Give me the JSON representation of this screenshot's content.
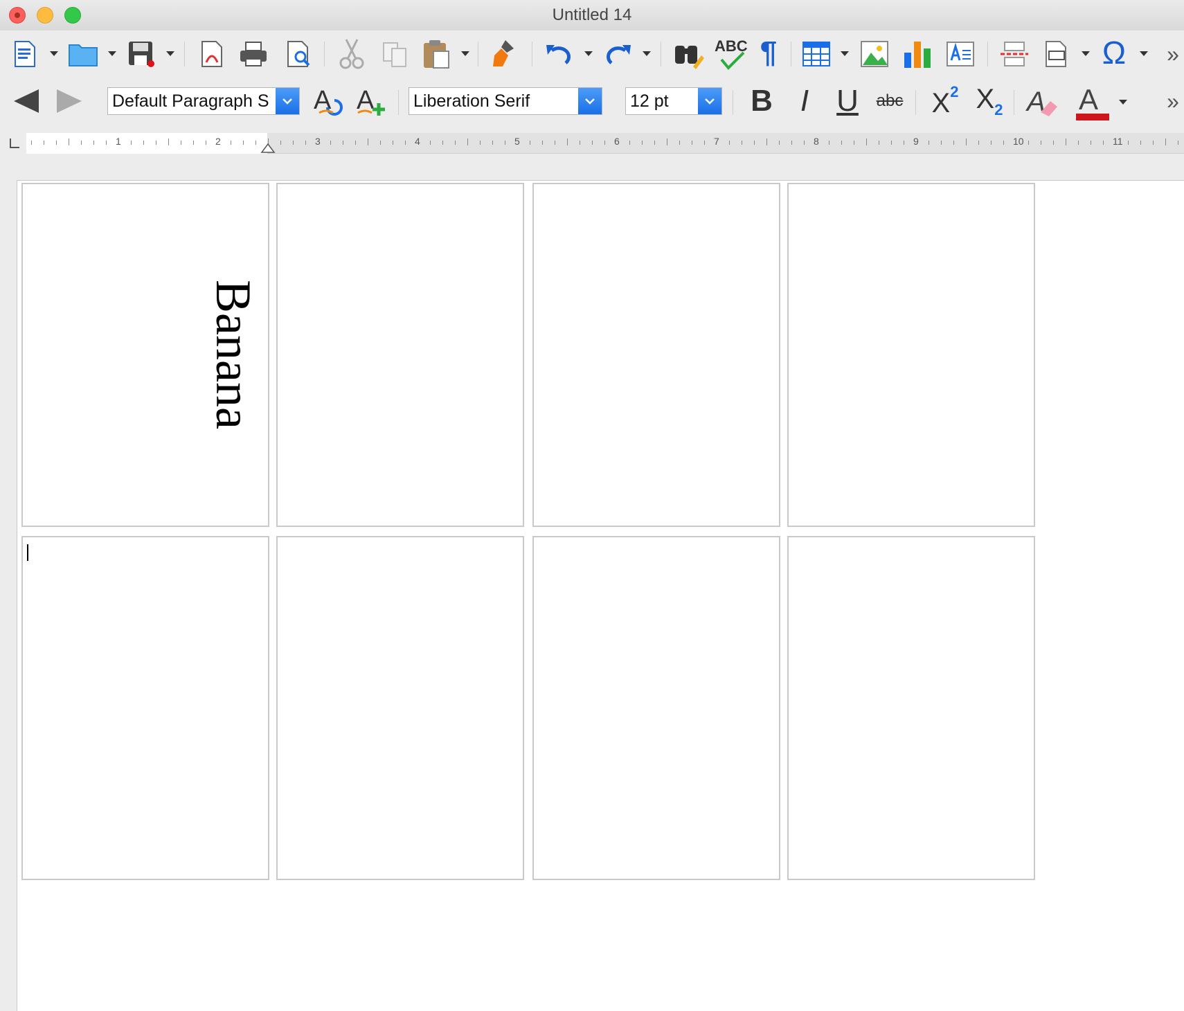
{
  "window": {
    "title": "Untitled 14"
  },
  "toolbar_standard": {
    "items": [
      {
        "name": "new-document",
        "icon": "document-icon"
      },
      {
        "name": "open",
        "icon": "folder-icon"
      },
      {
        "name": "save",
        "icon": "save-icon"
      },
      {
        "name": "export-pdf",
        "icon": "pdf-icon"
      },
      {
        "name": "print",
        "icon": "printer-icon"
      },
      {
        "name": "print-preview",
        "icon": "preview-icon"
      },
      {
        "name": "cut",
        "icon": "scissors-icon"
      },
      {
        "name": "copy",
        "icon": "copy-icon"
      },
      {
        "name": "paste",
        "icon": "clipboard-icon"
      },
      {
        "name": "clone-formatting",
        "icon": "paintbrush-icon"
      },
      {
        "name": "undo",
        "icon": "undo-icon"
      },
      {
        "name": "redo",
        "icon": "redo-icon"
      },
      {
        "name": "find-replace",
        "icon": "binoculars-icon"
      },
      {
        "name": "spelling",
        "icon": "spellcheck-icon"
      },
      {
        "name": "formatting-marks",
        "icon": "pilcrow-icon"
      },
      {
        "name": "insert-table",
        "icon": "table-icon"
      },
      {
        "name": "insert-image",
        "icon": "image-icon"
      },
      {
        "name": "insert-chart",
        "icon": "chart-icon"
      },
      {
        "name": "insert-textbox",
        "icon": "textbox-icon"
      },
      {
        "name": "page-break",
        "icon": "page-break-icon"
      },
      {
        "name": "insert-field",
        "icon": "field-icon"
      },
      {
        "name": "special-character",
        "icon": "omega-icon"
      }
    ],
    "spellcheck_label": "ABC",
    "omega_glyph": "Ω",
    "pilcrow_glyph": "¶",
    "overflow_glyph": "»"
  },
  "toolbar_format": {
    "paragraph_style": "Default Paragraph S",
    "font_name": "Liberation Serif",
    "font_size": "12 pt",
    "bold_glyph": "B",
    "italic_glyph": "I",
    "underline_glyph": "U",
    "strike_label": "abc",
    "superscript_base": "X",
    "superscript_exp": "2",
    "subscript_base": "X",
    "subscript_exp": "2",
    "font_color_glyph": "A",
    "font_color": "#d0161d",
    "overflow_glyph": "»"
  },
  "ruler": {
    "labels": [
      "1",
      "2",
      "3",
      "4",
      "5",
      "6",
      "7",
      "8",
      "9",
      "10",
      "11"
    ]
  },
  "document": {
    "cells": [
      {
        "text": "Banana"
      },
      {
        "text": ""
      },
      {
        "text": ""
      },
      {
        "text": ""
      },
      {
        "text": ""
      },
      {
        "text": ""
      },
      {
        "text": ""
      },
      {
        "text": ""
      }
    ]
  }
}
